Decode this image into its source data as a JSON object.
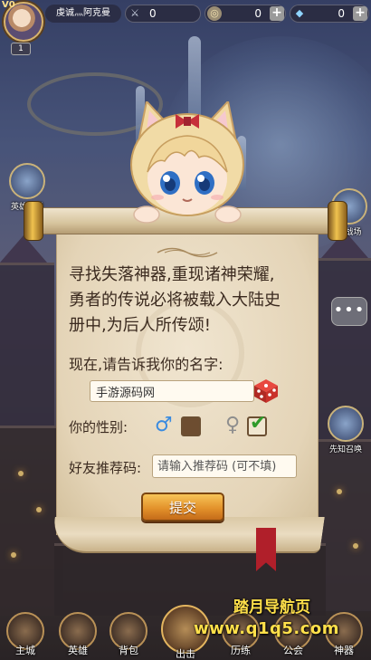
{
  "player": {
    "vip": "V0",
    "name": "虔诚灬阿克曼",
    "level": "1"
  },
  "resources": [
    {
      "icon": "crossed-swords-icon",
      "value": "0"
    },
    {
      "icon": "coin-icon",
      "value": "0"
    },
    {
      "icon": "diamond-icon",
      "value": "0"
    }
  ],
  "side_buttons": {
    "left": "英雄神殿",
    "right_top": "繁战场",
    "right_bottom": "先知召唤"
  },
  "chat_icon": "chat-bubble-icon",
  "dialog": {
    "story": [
      "寻找失落神器,重现诸神荣耀,",
      "勇者的传说必将被载入大陆史",
      "册中,为后人所传颂!"
    ],
    "prompt": "现在,请告诉我你的名字:",
    "name_value": "手游源码网",
    "gender_label": "你的性别:",
    "gender_selected": "female",
    "referral_label": "好友推荐码:",
    "referral_placeholder": "请输入推荐码 (可不填)",
    "submit_label": "提交"
  },
  "bottom_nav": [
    "主城",
    "英雄",
    "背包",
    "出击",
    "历练",
    "公会",
    "神器"
  ],
  "watermark": {
    "line1": "踏月导航页",
    "line2": "www.q1q5.com"
  },
  "colors": {
    "accent": "#e3922b",
    "male": "#3a8be0",
    "check": "#2f9a2a",
    "ribbon": "#b01f2a",
    "watermark": "#ffe04a"
  }
}
